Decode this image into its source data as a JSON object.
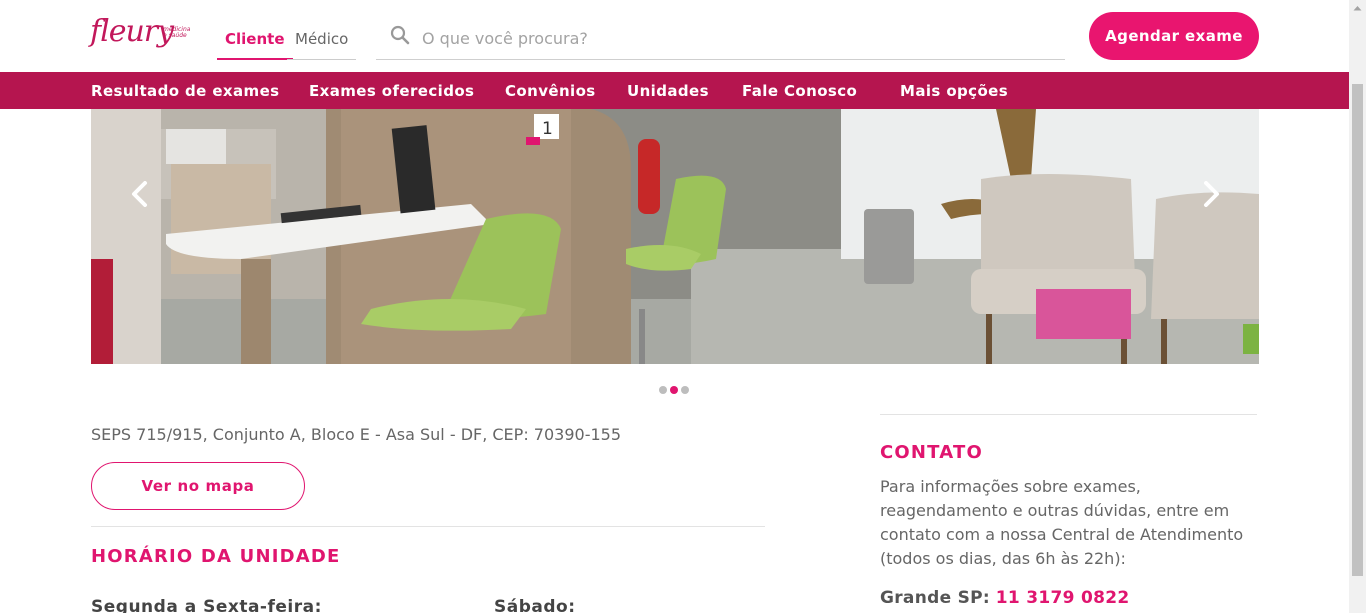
{
  "brand": {
    "logo_text": "fleury",
    "tagline_1": "medicina",
    "tagline_2": "e saúde",
    "accent": "#e9156f",
    "nav_bg": "#b5154f"
  },
  "header": {
    "tabs": [
      {
        "label": "Cliente"
      },
      {
        "label": "Médico"
      }
    ],
    "search_placeholder": "O que você procura?",
    "cta_label": "Agendar exame"
  },
  "nav": {
    "items": [
      {
        "label": "Resultado de exames"
      },
      {
        "label": "Exames oferecidos"
      },
      {
        "label": "Convênios"
      },
      {
        "label": "Unidades"
      },
      {
        "label": "Fale Conosco"
      },
      {
        "label": "Mais opções"
      }
    ]
  },
  "carousel": {
    "slide_count": 3,
    "active_index": 1,
    "prev_icon": "chevron-left-icon",
    "next_icon": "chevron-right-icon"
  },
  "unit": {
    "address": "SEPS 715/915, Conjunto A, Bloco E - Asa Sul - DF, CEP: 70390-155",
    "map_button": "Ver no mapa",
    "hours_title": "HORÁRIO DA UNIDADE",
    "weekdays_label": "Segunda a Sexta-feira:",
    "saturday_label": "Sábado:"
  },
  "contact": {
    "title": "CONTATO",
    "text": "Para informações sobre exames, reagendamento e outras dúvidas, entre em contato com a nossa Central de Atendimento (todos os dias, das 6h às 22h):",
    "phone_label": "Grande SP:",
    "phone_number": "11 3179 0822"
  }
}
